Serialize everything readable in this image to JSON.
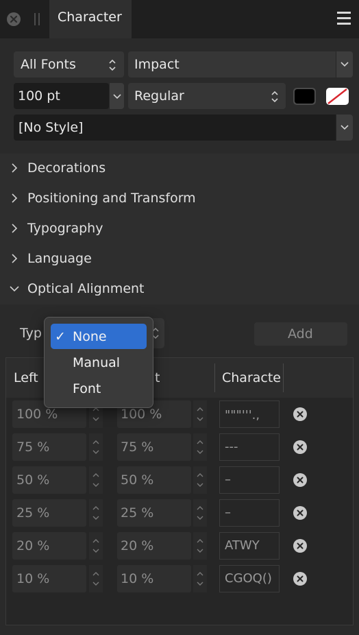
{
  "window": {
    "tab_title": "Character"
  },
  "font": {
    "collection": "All Fonts",
    "family": "Impact",
    "size": "100 pt",
    "style": "Regular",
    "paragraph_style": "[No Style]",
    "text_color": "#000000",
    "stroke_color": "none"
  },
  "sections": [
    {
      "label": "Decorations",
      "expanded": false
    },
    {
      "label": "Positioning and Transform",
      "expanded": false
    },
    {
      "label": "Typography",
      "expanded": false
    },
    {
      "label": "Language",
      "expanded": false
    },
    {
      "label": "Optical Alignment",
      "expanded": true
    }
  ],
  "optical": {
    "type_label": "Typ",
    "add_label": "Add",
    "columns": [
      "Left",
      "t",
      "Characte"
    ],
    "rows": [
      {
        "left": "100 %",
        "right": "100 %",
        "chars": "\"\"\"'''.,"
      },
      {
        "left": "75 %",
        "right": "75 %",
        "chars": "---"
      },
      {
        "left": "50 %",
        "right": "50 %",
        "chars": "–"
      },
      {
        "left": "25 %",
        "right": "25 %",
        "chars": "–"
      },
      {
        "left": "20 %",
        "right": "20 %",
        "chars": "ATWY"
      },
      {
        "left": "10 %",
        "right": "10 %",
        "chars": "CGOQ()"
      }
    ]
  },
  "dropdown": {
    "options": [
      "None",
      "Manual",
      "Font"
    ],
    "selected": "None",
    "check_mark": "✓"
  }
}
